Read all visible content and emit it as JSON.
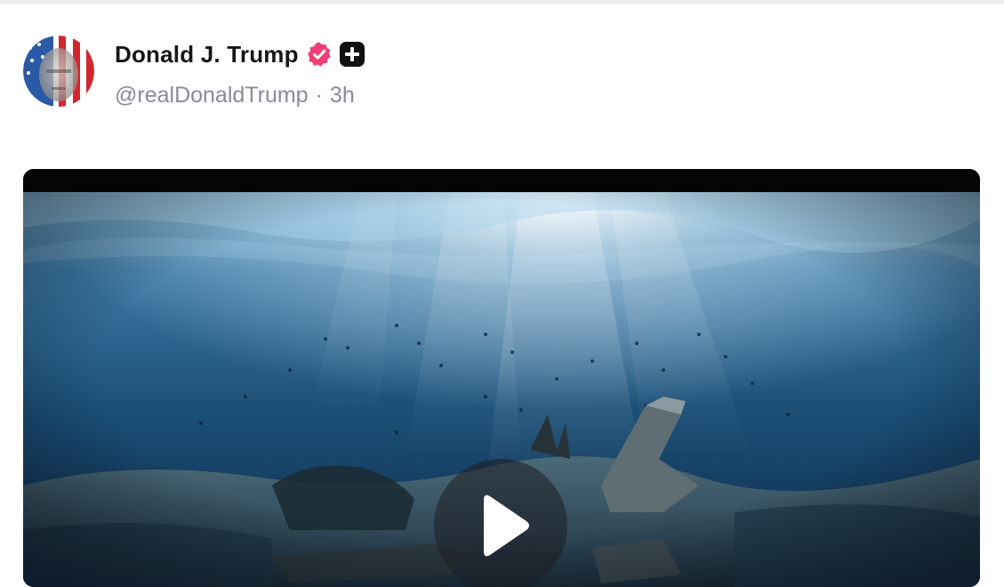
{
  "post": {
    "author": {
      "display_name": "Donald J. Trump",
      "handle": "@realDonaldTrump",
      "verified": true,
      "avatar_icon": "avatar-flag-portrait-icon",
      "badges": [
        "verified-badge-icon",
        "plus-badge-icon"
      ]
    },
    "separator": "·",
    "timestamp": "3h",
    "media": {
      "type": "video",
      "content": "underwater scene with sun rays and sunken wreckage",
      "play_icon": "play-icon"
    }
  },
  "colors": {
    "verified": "#ee3f76",
    "name_text": "#16161a",
    "meta_text": "#8a8a99",
    "plus_badge_bg": "#111111"
  }
}
